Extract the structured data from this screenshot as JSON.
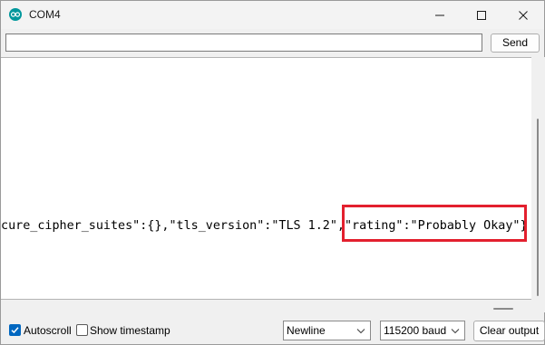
{
  "window": {
    "title": "COM4"
  },
  "send_bar": {
    "input_value": "",
    "send_label": "Send"
  },
  "output": {
    "visible_line": "-cure_cipher_suites\":{},\"tls_version\":\"TLS 1.2\",\"rating\":\"Probably Okay\"}",
    "highlighted_text": "\"rating\":\"Probably Okay\"",
    "highlight_color": "#e3202e"
  },
  "bottom_bar": {
    "autoscroll_label": "Autoscroll",
    "autoscroll_checked": true,
    "timestamp_label": "Show timestamp",
    "timestamp_checked": false,
    "line_ending_selected": "Newline",
    "baud_selected": "115200 baud",
    "clear_label": "Clear output"
  },
  "colors": {
    "accent": "#0067c0",
    "app_icon": "#00979c"
  },
  "icons": [
    "arduino-logo-icon",
    "minimize-icon",
    "maximize-icon",
    "close-icon",
    "checkmark-icon",
    "chevron-down-icon"
  ]
}
